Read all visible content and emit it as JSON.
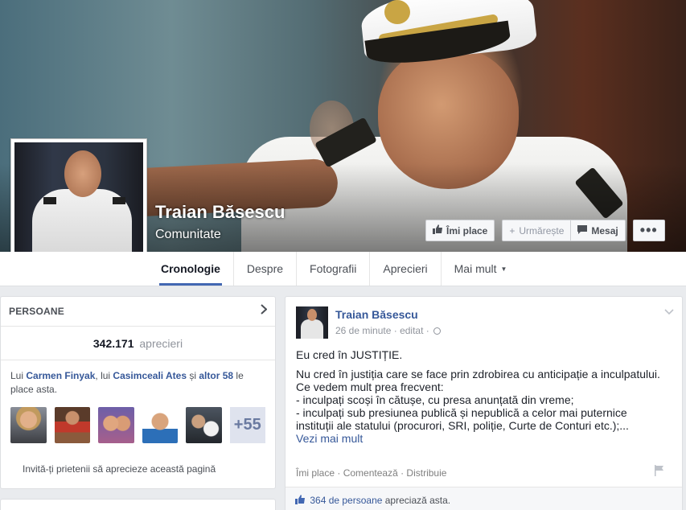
{
  "page": {
    "name": "Traian Băsescu",
    "category": "Comunitate"
  },
  "actions": {
    "like_label": "Îmi place",
    "follow_label": "Urmărește",
    "message_label": "Mesaj",
    "more_label": "•••"
  },
  "tabs": [
    {
      "label": "Cronologie",
      "active": true
    },
    {
      "label": "Despre"
    },
    {
      "label": "Fotografii"
    },
    {
      "label": "Aprecieri"
    },
    {
      "label": "Mai mult"
    }
  ],
  "people": {
    "title": "PERSOANE",
    "likes_count": "342.171",
    "likes_word": "aprecieri",
    "friends": {
      "prefix": "Lui ",
      "name1": "Carmen Finyak",
      "sep1": ", lui ",
      "name2": "Casimceali Ates",
      "sep2": " și ",
      "name3": "altor 58",
      "suffix": " le place asta."
    },
    "more_count": "+55",
    "invite_text": "Invită-ți prietenii să aprecieze această pagină"
  },
  "post": {
    "author": "Traian Băsescu",
    "time": "26 de minute",
    "edited": "editat",
    "headline": "Eu cred în JUSTIȚIE.",
    "body_lines": [
      "Nu cred în justiția care se face prin zdrobirea cu anticipație a inculpatului.",
      "Ce vedem mult prea frecvent:",
      "- inculpați scoși în cătușe, cu presa anunțată din vreme;",
      "- inculpați sub presiunea publică și nepublică a celor mai puternice",
      "instituții ale statului (procurori, SRI, poliție, Curte de Conturi etc.);..."
    ],
    "see_more": "Vezi mai mult",
    "actions": {
      "like": "Îmi place",
      "comment": "Comentează",
      "share": "Distribuie"
    },
    "likes_link": "364 de persoane",
    "likes_suffix": " apreciază asta."
  }
}
